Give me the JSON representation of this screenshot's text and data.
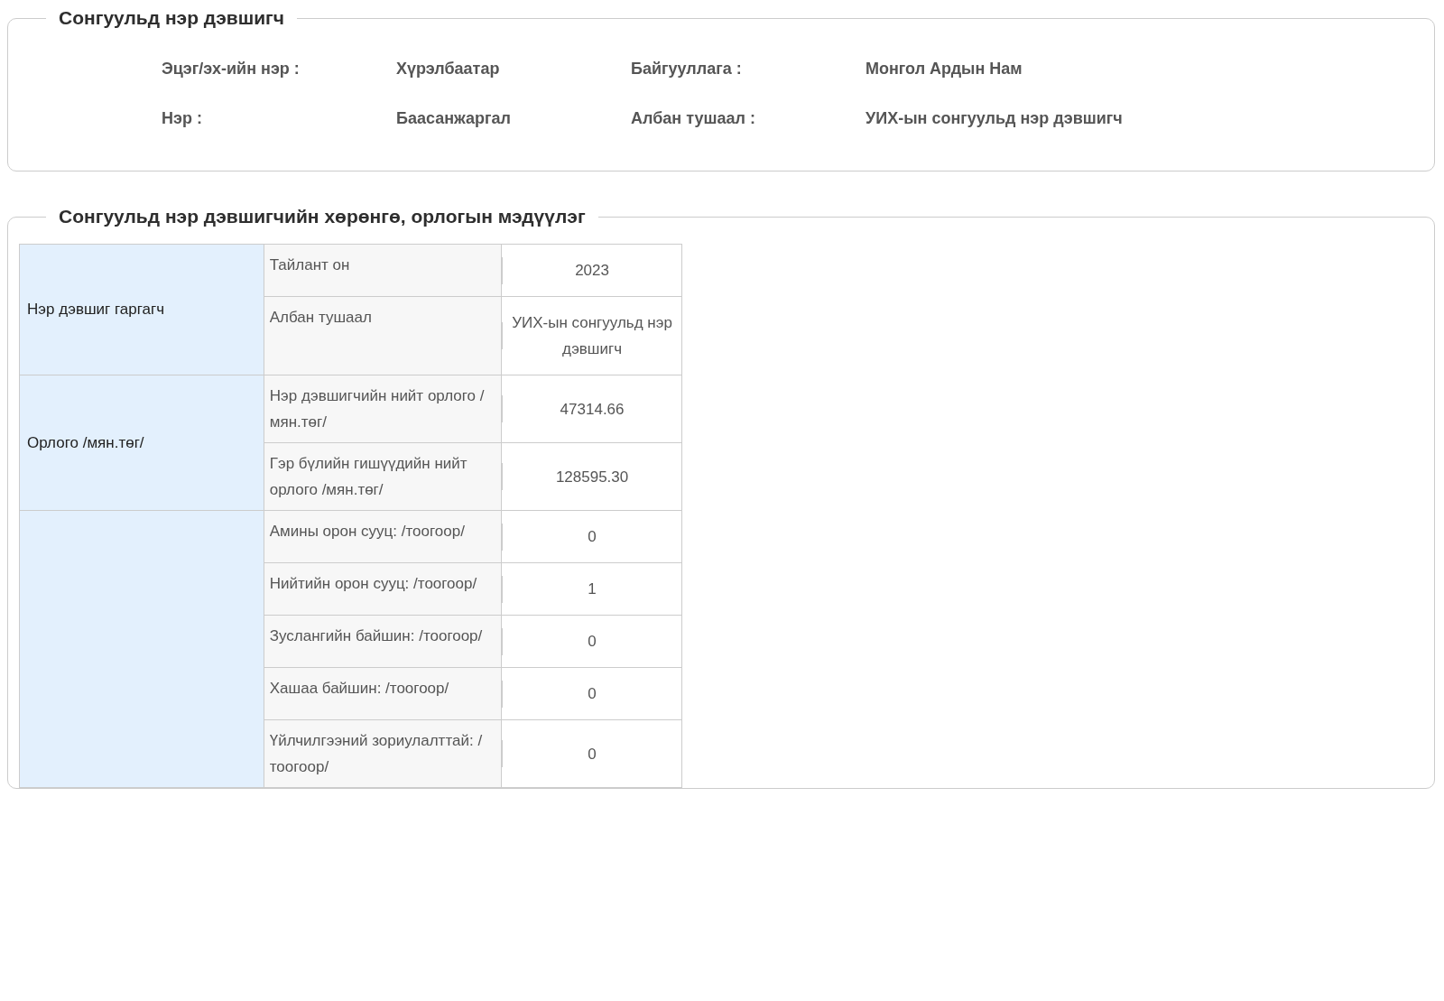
{
  "candidate_section": {
    "title": "Сонгуульд нэр дэвшигч",
    "fields": [
      {
        "label": "Эцэг/эх-ийн нэр :",
        "value": "Хүрэлбаатар"
      },
      {
        "label": "Байгууллага :",
        "value": "Монгол Ардын Нам"
      },
      {
        "label": "Нэр :",
        "value": "Баасанжаргал"
      },
      {
        "label": "Албан тушаал :",
        "value": "УИХ-ын сонгуульд нэр дэвшигч"
      }
    ]
  },
  "declaration_section": {
    "title": "Сонгуульд нэр дэвшигчийн хөрөнгө, орлогын мэдүүлэг",
    "table": {
      "groups": [
        {
          "label": "Нэр дэвшиг гаргагч",
          "rows": [
            {
              "label": "Тайлант он",
              "value": "2023"
            },
            {
              "label": "Албан тушаал",
              "value": "УИХ-ын сонгуульд нэр дэвшигч"
            }
          ]
        },
        {
          "label": "Орлого /мян.төг/",
          "rows": [
            {
              "label": "Нэр дэвшигчийн нийт орлого /мян.төг/",
              "value": "47314.66"
            },
            {
              "label": "Гэр бүлийн гишүүдийн нийт орлого /мян.төг/",
              "value": "128595.30"
            }
          ]
        },
        {
          "rows": [
            {
              "label": "Амины орон сууц: /тоогоор/",
              "value": "0"
            },
            {
              "label": "Нийтийн орон сууц: /тоогоор/",
              "value": "1"
            },
            {
              "label": "Зуслангийн байшин: /тоогоор/",
              "value": "0"
            },
            {
              "label": "Хашаа байшин: /тоогоор/",
              "value": "0"
            },
            {
              "label": "Үйлчилгээний зориулалттай: /тоогоор/",
              "value": "0"
            }
          ]
        }
      ]
    }
  }
}
